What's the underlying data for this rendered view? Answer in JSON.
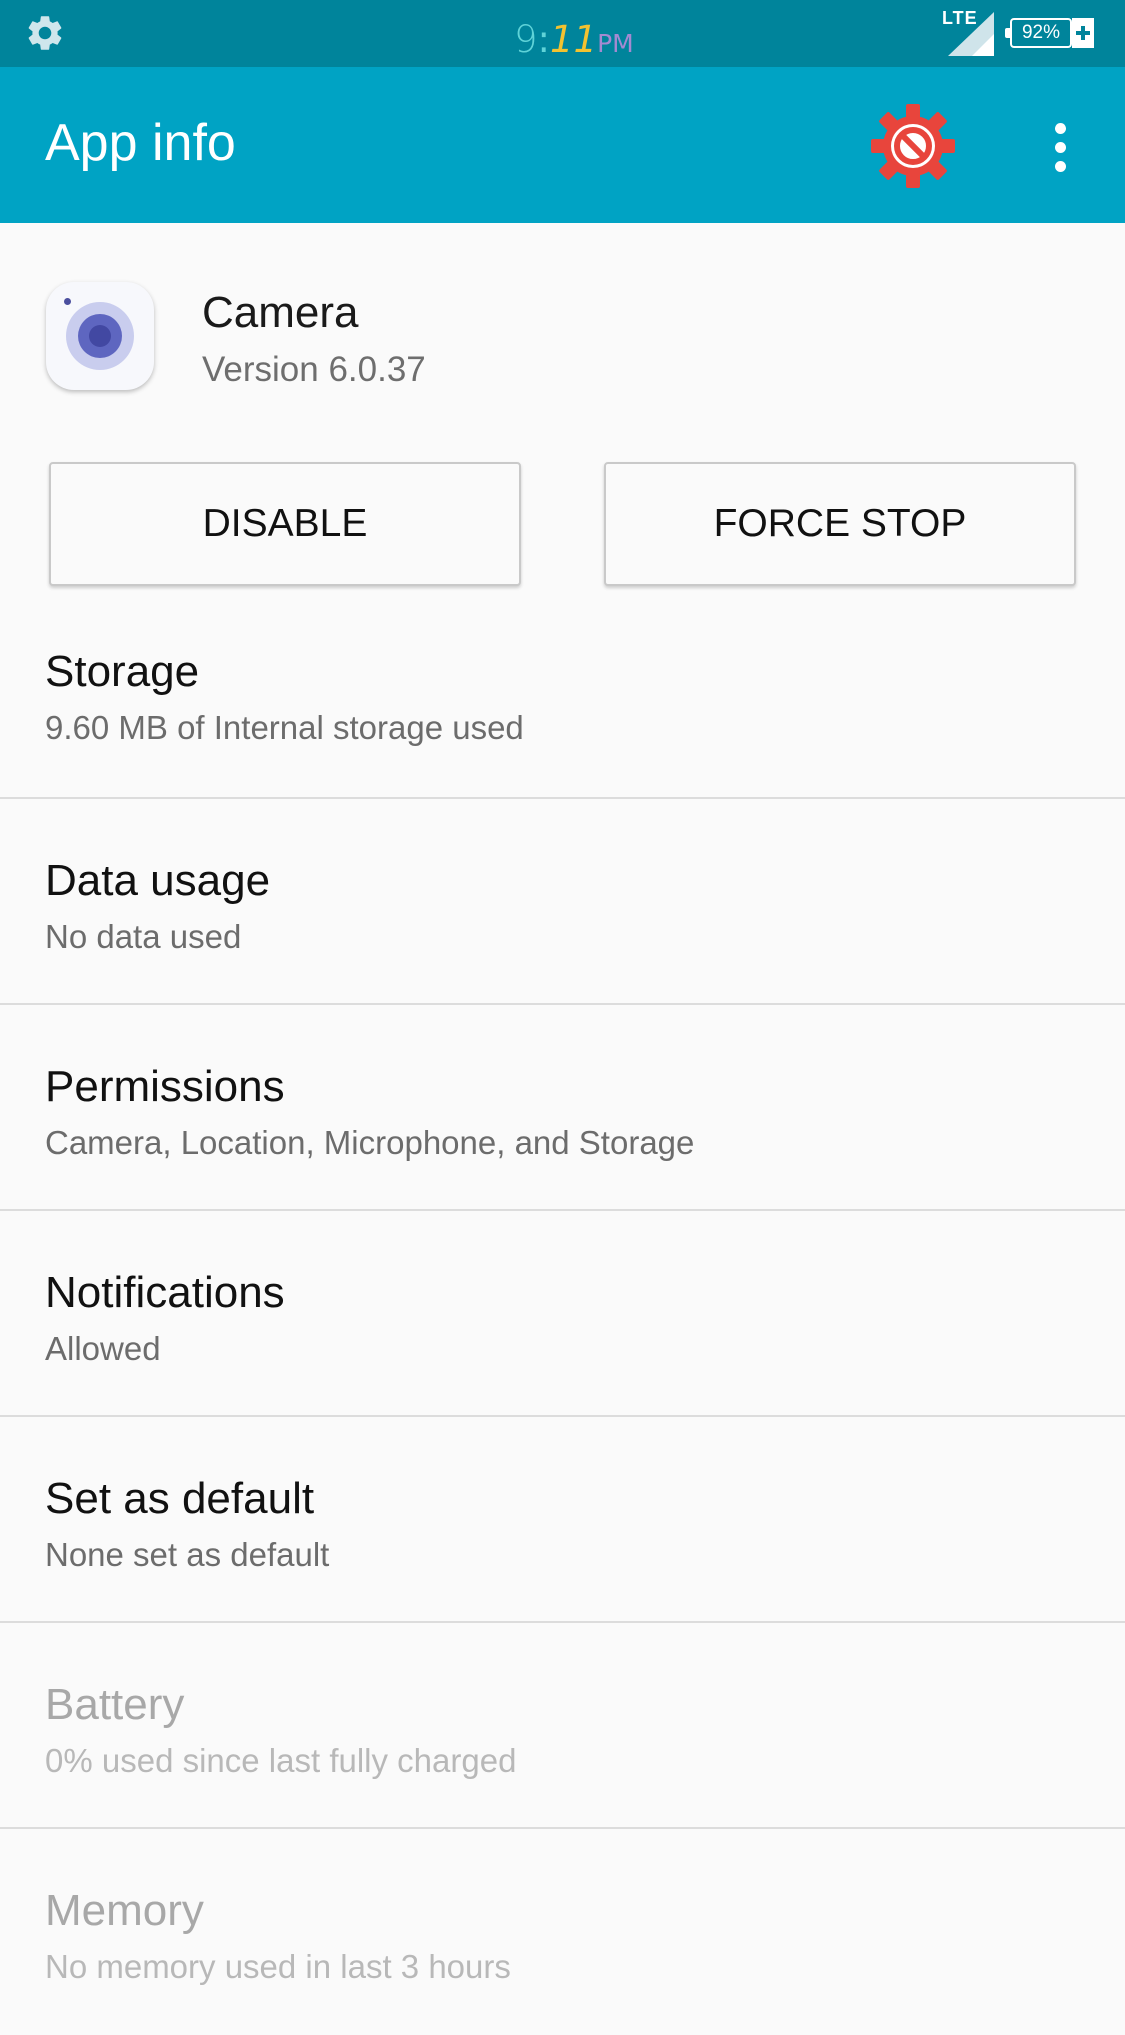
{
  "status_bar": {
    "time_hour": "9",
    "time_sep": ":",
    "time_minute": "11",
    "time_ampm": "PM",
    "network": "LTE",
    "battery": "92%",
    "settings_icon": "gear-icon",
    "signal_icon": "signal-icon",
    "charging_icon": "charging-plus-icon"
  },
  "app_bar": {
    "title": "App info",
    "action_icon": "settings-blocked-icon",
    "menu_icon": "more-vert-icon",
    "color": "#00a3c4"
  },
  "app": {
    "name": "Camera",
    "version": "Version 6.0.37",
    "icon": "camera-app-icon"
  },
  "buttons": {
    "disable": "DISABLE",
    "force_stop": "FORCE STOP"
  },
  "items": [
    {
      "title": "Storage",
      "subtitle": "9.60 MB of Internal storage used",
      "enabled": true
    },
    {
      "title": "Data usage",
      "subtitle": "No data used",
      "enabled": true
    },
    {
      "title": "Permissions",
      "subtitle": "Camera, Location, Microphone, and Storage",
      "enabled": true
    },
    {
      "title": "Notifications",
      "subtitle": "Allowed",
      "enabled": true
    },
    {
      "title": "Set as default",
      "subtitle": "None set as default",
      "enabled": true
    },
    {
      "title": "Battery",
      "subtitle": "0% used since last fully charged",
      "enabled": false
    },
    {
      "title": "Memory",
      "subtitle": "No memory used in last 3 hours",
      "enabled": false
    }
  ]
}
